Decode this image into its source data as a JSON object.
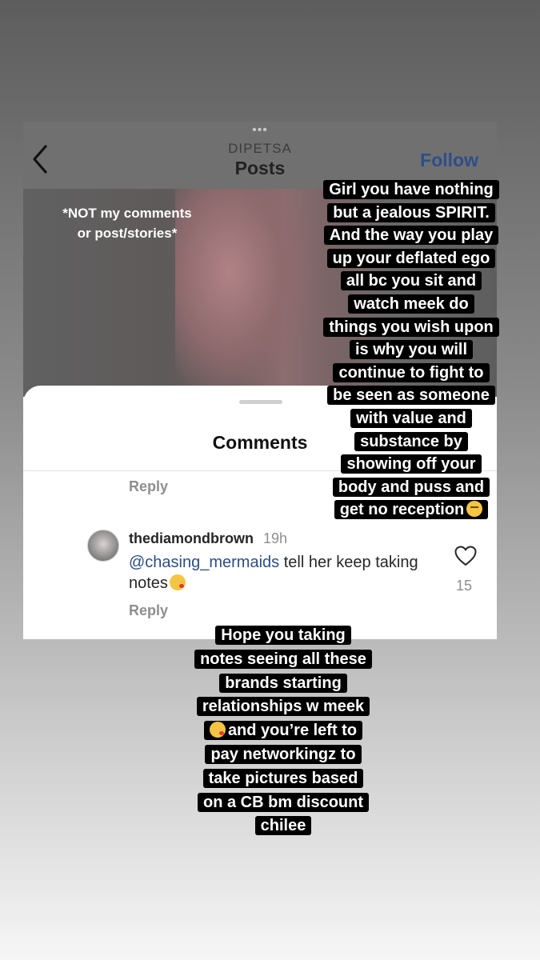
{
  "screenshot": {
    "header": {
      "dots": "•••",
      "account": "DIPETSA",
      "title": "Posts",
      "follow_label": "Follow"
    },
    "photo_note": "*NOT my comments or post/stories*",
    "comments_sheet": {
      "title": "Comments",
      "reply_label": "Reply",
      "comment": {
        "username": "thediamondbrown",
        "time": "19h",
        "mention": "@chasing_mermaids",
        "text": " tell her keep taking notes",
        "emoji": "kissing-face-emoji",
        "reply_label": "Reply",
        "like_count": "15"
      }
    }
  },
  "overlay_1": {
    "lines": [
      "Girl you have nothing",
      "but a jealous SPIRIT.",
      "And the way you play",
      "up your deflated ego",
      "all bc you sit and",
      "watch meek do",
      "things you wish upon",
      "is why you will",
      "continue to fight to",
      "be seen as someone",
      "with value and",
      "substance by",
      "showing off your",
      "body and puss and",
      "get no reception"
    ],
    "emoji": "face-with-rolling-eyes-emoji"
  },
  "overlay_2": {
    "lines": [
      "Hope you taking",
      "notes seeing all these",
      "brands starting",
      "relationships w meek",
      "and you’re left to",
      "pay networkingz to",
      "take pictures based",
      "on a CB bm discount",
      "chilee"
    ],
    "emoji": "face-blowing-kiss-emoji"
  },
  "colors": {
    "follow": "#2d4e8a",
    "mention": "#2c4d84",
    "overlay_bg": "#000000",
    "overlay_text": "#ffffff"
  }
}
